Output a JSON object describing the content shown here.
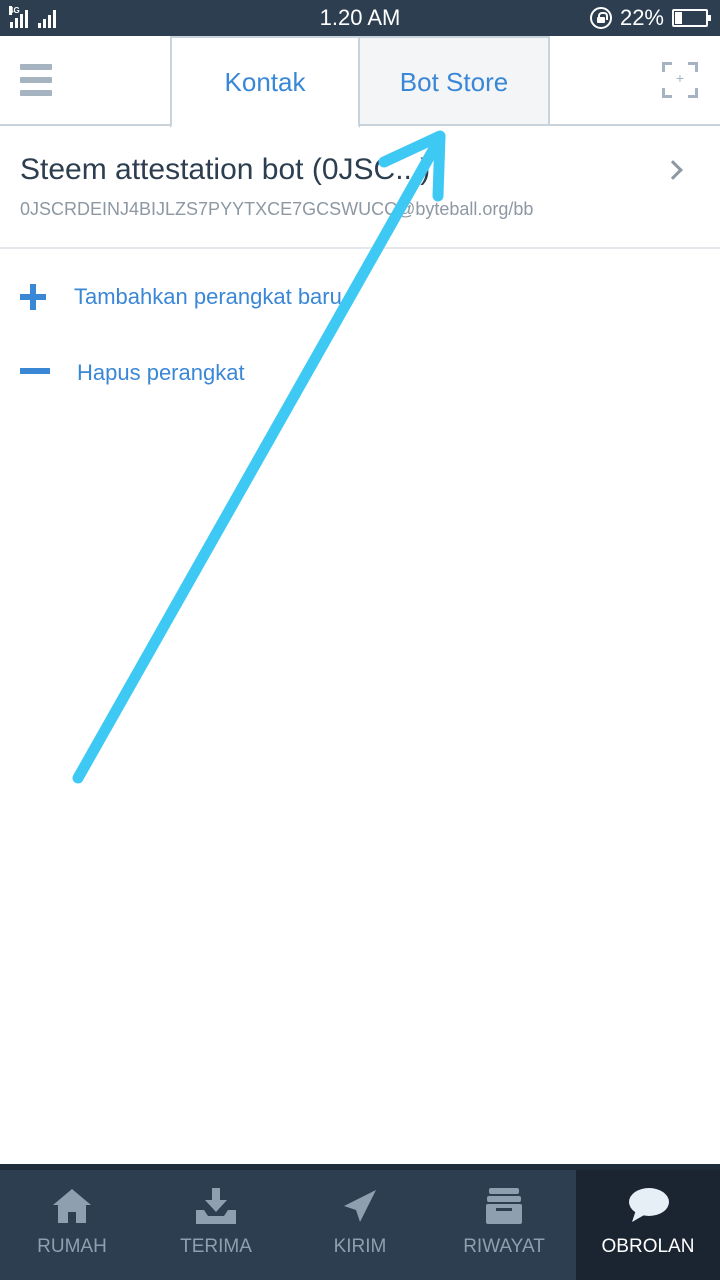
{
  "status_bar": {
    "network": "4G",
    "time": "1.20 AM",
    "battery_percent": "22%",
    "battery_level": 0.22
  },
  "header": {
    "menu_icon": "hamburger-menu-icon",
    "tabs": [
      {
        "label": "Kontak",
        "active": true
      },
      {
        "label": "Bot Store",
        "active": false
      }
    ],
    "scan_icon": "qr-scan-icon"
  },
  "contacts": [
    {
      "name": "Steem attestation bot (0JSC...)",
      "address": "0JSCRDEINJ4BIJLZS7PYYTXCE7GCSWUCC@byteball.org/bb"
    }
  ],
  "actions": {
    "add_device": "Tambahkan perangkat baru",
    "remove_device": "Hapus perangkat"
  },
  "bottom_nav": [
    {
      "label": "RUMAH",
      "icon": "home-icon",
      "active": false
    },
    {
      "label": "TERIMA",
      "icon": "receive-icon",
      "active": false
    },
    {
      "label": "KIRIM",
      "icon": "send-icon",
      "active": false
    },
    {
      "label": "RIWAYAT",
      "icon": "history-icon",
      "active": false
    },
    {
      "label": "OBROLAN",
      "icon": "chat-icon",
      "active": true
    }
  ],
  "colors": {
    "status_bar": "#2c3e50",
    "accent": "#3a87d6",
    "annotation_arrow": "#3ec9f5",
    "nav_background": "#2c3e50",
    "nav_active": "#1a2531"
  }
}
